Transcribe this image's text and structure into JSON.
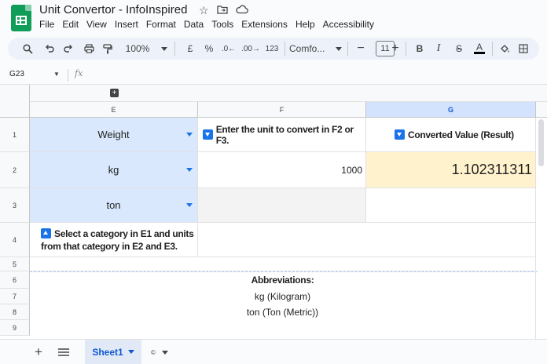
{
  "title": "Unit Convertor - InfoInspired",
  "title_icons": [
    "star-icon",
    "move-to-folder-icon",
    "cloud-status-icon"
  ],
  "menu": [
    "File",
    "Edit",
    "View",
    "Insert",
    "Format",
    "Data",
    "Tools",
    "Extensions",
    "Help",
    "Accessibility"
  ],
  "toolbar": {
    "zoom": "100%",
    "currency": "£",
    "percent": "%",
    "dec_decrease": ".0←",
    "dec_increase": ".00→",
    "number_format": "123",
    "font": "Comfo...",
    "font_size": "11",
    "bold": "B",
    "italic": "I",
    "strike": "S",
    "text_color": "A"
  },
  "formula_bar": {
    "cell_ref": "G23",
    "fx": "fx",
    "value": ""
  },
  "columns": [
    "E",
    "F",
    "G"
  ],
  "selected_column": "G",
  "rows": [
    "1",
    "2",
    "3",
    "4",
    "5",
    "6",
    "7",
    "8",
    "9"
  ],
  "cells": {
    "E1": "Weight",
    "F1": "Enter the unit to convert in F2 or F3.",
    "G1": "Converted Value (Result)",
    "E2": "kg",
    "F2": "1000",
    "G2": "1.102311311",
    "E3": "ton",
    "E4": "Select a category in E1 and units from that category in E2 and E3.",
    "E6": "Abbreviations:",
    "E7": "kg (Kilogram)",
    "E8": "ton (Ton (Metric))"
  },
  "sheets": [
    {
      "name": "Sheet1",
      "active": true
    }
  ],
  "colors": {
    "accent": "#0b57d0",
    "input_blue": "#d9e8fc",
    "result_yellow": "#fff2cc",
    "sheets_green": "#0f9d58"
  }
}
